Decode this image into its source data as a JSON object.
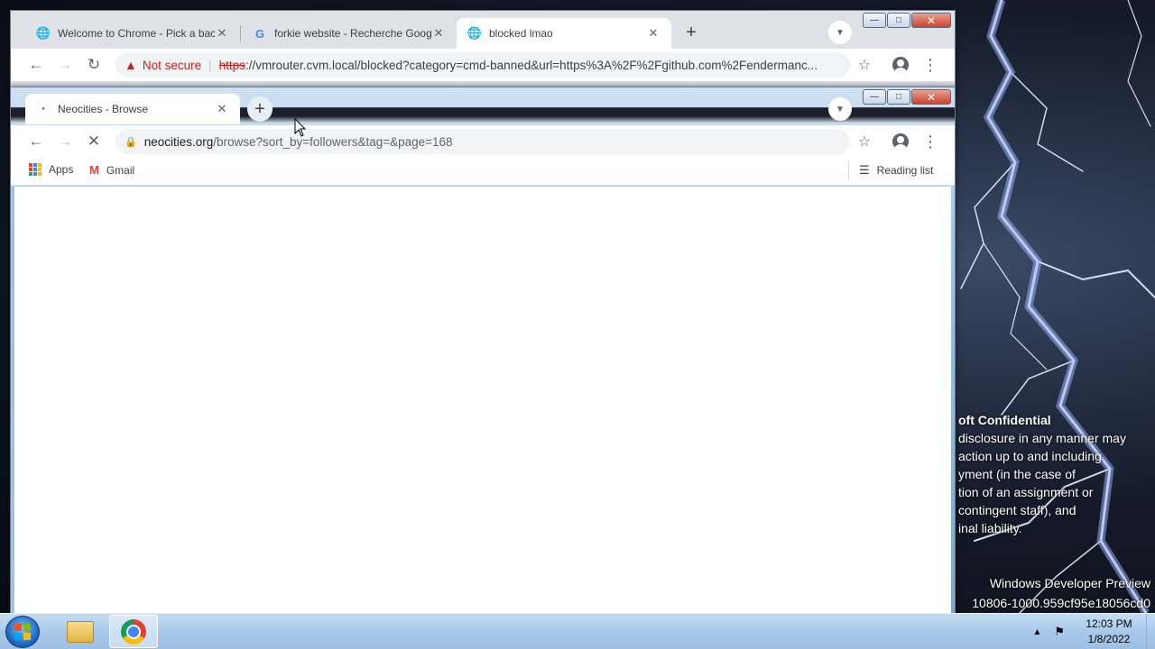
{
  "desktop": {
    "watermark_lines": [
      "oft Confidential",
      "disclosure in any manner may",
      "action up to and including",
      "yment (in the case of",
      "tion of an assignment or",
      "contingent staff), and",
      "inal liability."
    ],
    "dev_preview_line1": "Windows Developer Preview",
    "dev_preview_line2": "10806-1000.959cf95e18056cd0"
  },
  "back_window": {
    "tabs": [
      {
        "title": "Welcome to Chrome - Pick a background",
        "icon": "globe-icon"
      },
      {
        "title": "forkie website - Recherche Google",
        "icon": "google-icon"
      },
      {
        "title": "blocked lmao",
        "icon": "globe-icon"
      }
    ],
    "not_secure_label": "Not secure",
    "url_scheme": "https",
    "url_rest": "://vmrouter.cvm.local/blocked?category=cmd-banned&url=https%3A%2F%2Fgithub.com%2Fendermanc..."
  },
  "front_window": {
    "tab_title": "Neocities - Browse",
    "url_host": "neocities.org",
    "url_path": "/browse?sort_by=followers&tag=&page=168",
    "bookmarks": [
      {
        "label": "Apps",
        "icon": "apps-grid-icon"
      },
      {
        "label": "Gmail",
        "icon": "gmail-icon"
      }
    ],
    "reading_list_label": "Reading list"
  },
  "taskbar": {
    "time": "12:03 PM",
    "date": "1/8/2022"
  }
}
